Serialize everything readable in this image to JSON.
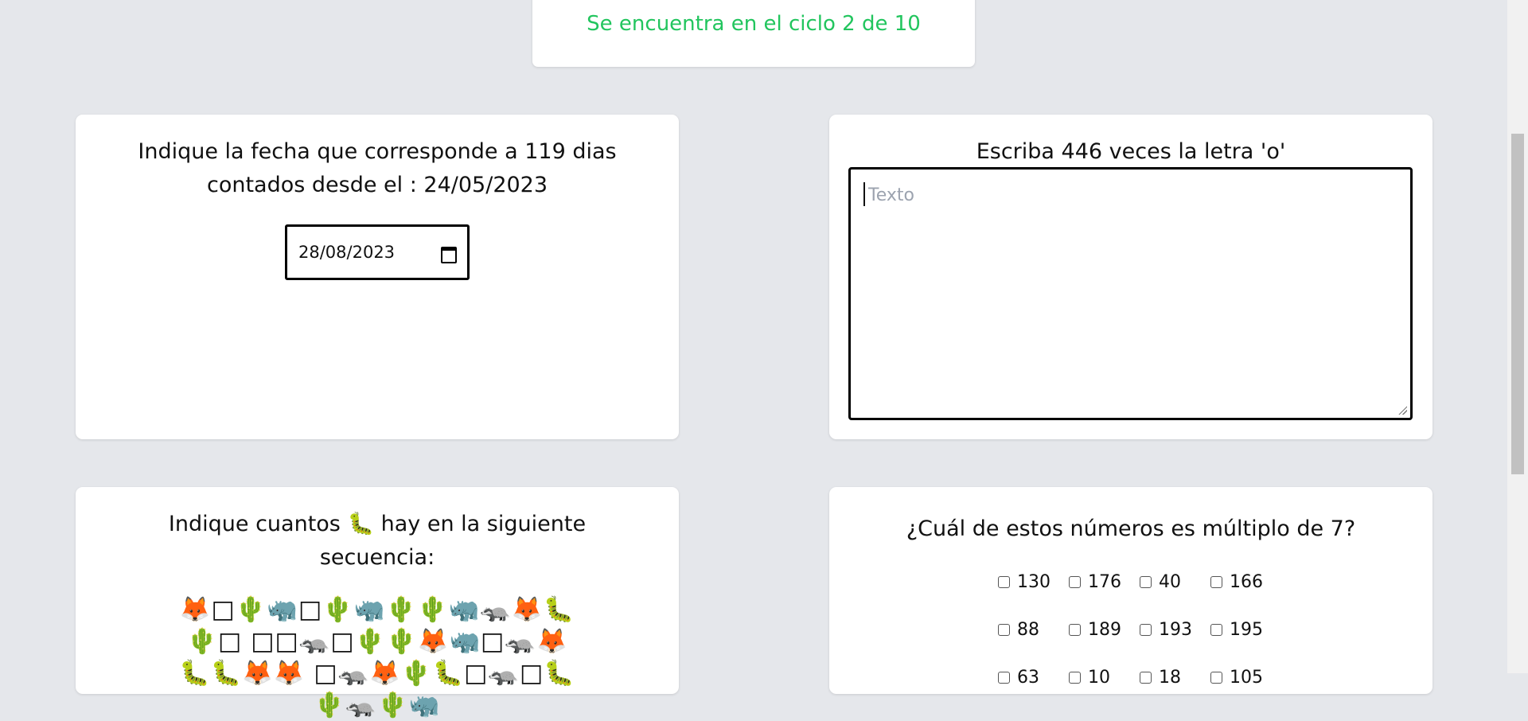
{
  "header": {
    "cycle_text": "Se encuentra en el ciclo 2 de 10"
  },
  "date_card": {
    "prompt": "Indique la fecha que corresponde a 119 dias contados desde el : 24/05/2023",
    "date_value": "28/08/2023",
    "icon": "calendar-icon"
  },
  "text_card": {
    "prompt": "Escriba 446 veces la letra 'o'",
    "placeholder": "Texto"
  },
  "emoji_card": {
    "prompt": "Indique cuantos 🐛 hay en la siguiente secuencia:",
    "sequence": "🦊□🌵🦏□🌵🦏🌵🌵🦏🦡🦊🐛🌵□ □□🦡□🌵🌵🦊🦏□🦡🦊🐛🐛🦊🦊 □🦡🦊🌵🐛□🦡□🐛🌵🦡🌵🦏"
  },
  "multiple_card": {
    "prompt": "¿Cuál de estos números es múltiplo de 7?",
    "options": [
      "130",
      "176",
      "40",
      "166",
      "88",
      "189",
      "193",
      "195",
      "63",
      "10",
      "18",
      "105"
    ]
  },
  "colors": {
    "accent_green": "#22c55e",
    "background": "#e5e7eb"
  }
}
